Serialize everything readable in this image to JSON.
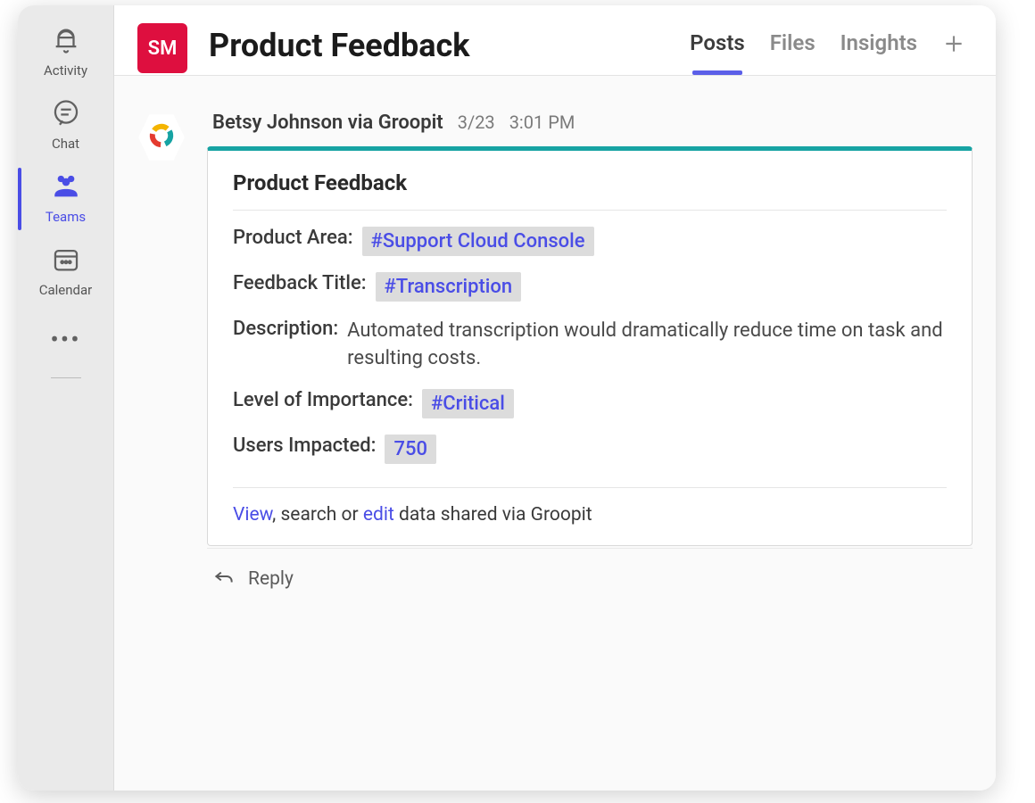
{
  "rail": {
    "items": [
      {
        "label": "Activity",
        "icon": "bell"
      },
      {
        "label": "Chat",
        "icon": "chat"
      },
      {
        "label": "Teams",
        "icon": "teams"
      },
      {
        "label": "Calendar",
        "icon": "calendar"
      }
    ]
  },
  "header": {
    "badge": "SM",
    "title": "Product Feedback",
    "tabs": [
      {
        "label": "Posts"
      },
      {
        "label": "Files"
      },
      {
        "label": "Insights"
      }
    ]
  },
  "post": {
    "author": "Betsy Johnson via Groopit",
    "date": "3/23",
    "time": "3:01 PM",
    "card": {
      "title": "Product Feedback",
      "product_area_label": "Product Area:",
      "product_area_value": "#Support Cloud Console",
      "feedback_title_label": "Feedback Title:",
      "feedback_title_value": "#Transcription",
      "description_label": "Description:",
      "description_value": "Automated transcription would dramatically reduce time on task and resulting costs.",
      "importance_label": "Level of Importance:",
      "importance_value": "#Critical",
      "users_label": "Users Impacted:",
      "users_value": "750",
      "footer_view": "View",
      "footer_mid": ", search or ",
      "footer_edit": "edit",
      "footer_tail": " data shared via Groopit"
    },
    "reply_label": "Reply"
  }
}
